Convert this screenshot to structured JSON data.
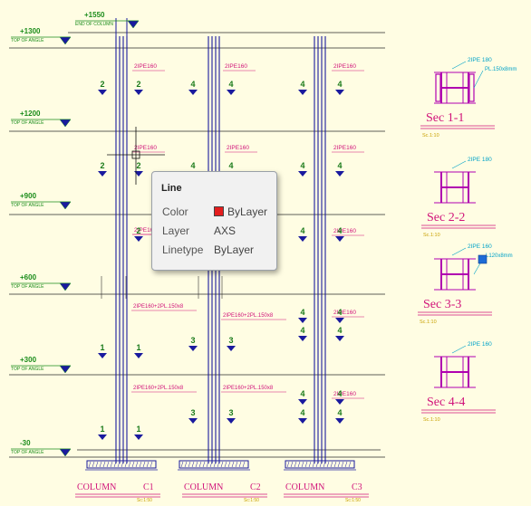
{
  "levels": [
    {
      "value": "+1550",
      "sub": "END OF COLUMN"
    },
    {
      "value": "+1300",
      "sub": "TOP OF ANGLE"
    },
    {
      "value": "+1200",
      "sub": "TOP OF ANGLE"
    },
    {
      "value": "+900",
      "sub": "TOP OF ANGLE"
    },
    {
      "value": "+600",
      "sub": "TOP OF ANGLE"
    },
    {
      "value": "+300",
      "sub": "TOP OF ANGLE"
    },
    {
      "value": "-30",
      "sub": "TOP OF ANGLE"
    }
  ],
  "member_labels": {
    "ipe": "2IPE160",
    "ipe_pl": "2IPE160+2PL.150x8",
    "ipe_partial": "2IPE16"
  },
  "section_marks": [
    "1",
    "2",
    "3",
    "4"
  ],
  "columns": [
    {
      "name": "COLUMN",
      "id": "C1",
      "sub": "Sc:1:50"
    },
    {
      "name": "COLUMN",
      "id": "C2",
      "sub": "Sc:1:50"
    },
    {
      "name": "COLUMN",
      "id": "C3",
      "sub": "Sc:1:50"
    }
  ],
  "sections": [
    {
      "title": "Sec 1-1",
      "scale": "Sc.1:10",
      "labels": [
        "2IPE 180",
        "PL.150x8mm"
      ]
    },
    {
      "title": "Sec 2-2",
      "scale": "Sc.1:10",
      "labels": [
        "2IPE 180"
      ]
    },
    {
      "title": "Sec 3-3",
      "scale": "Sc.1:10",
      "labels": [
        "2IPE 160",
        "L120x8mm"
      ]
    },
    {
      "title": "Sec 4-4",
      "scale": "Sc.1:10",
      "labels": [
        "2IPE 160"
      ]
    }
  ],
  "tooltip": {
    "title": "Line",
    "rows": [
      {
        "label": "Color",
        "value": "ByLayer",
        "swatch": "#e41d1d"
      },
      {
        "label": "Layer",
        "value": "AXS"
      },
      {
        "label": "Linetype",
        "value": "ByLayer"
      }
    ]
  },
  "colors": {
    "background": "#fffde3",
    "column": "#1a1a9e",
    "grid": "#2a2a2a",
    "label": "#d1137a",
    "level_marker": "#1a8c1a",
    "section_steel": "#b000b0",
    "cyan_note": "#00a2c8",
    "selected_grip": "#1e6bd6"
  }
}
